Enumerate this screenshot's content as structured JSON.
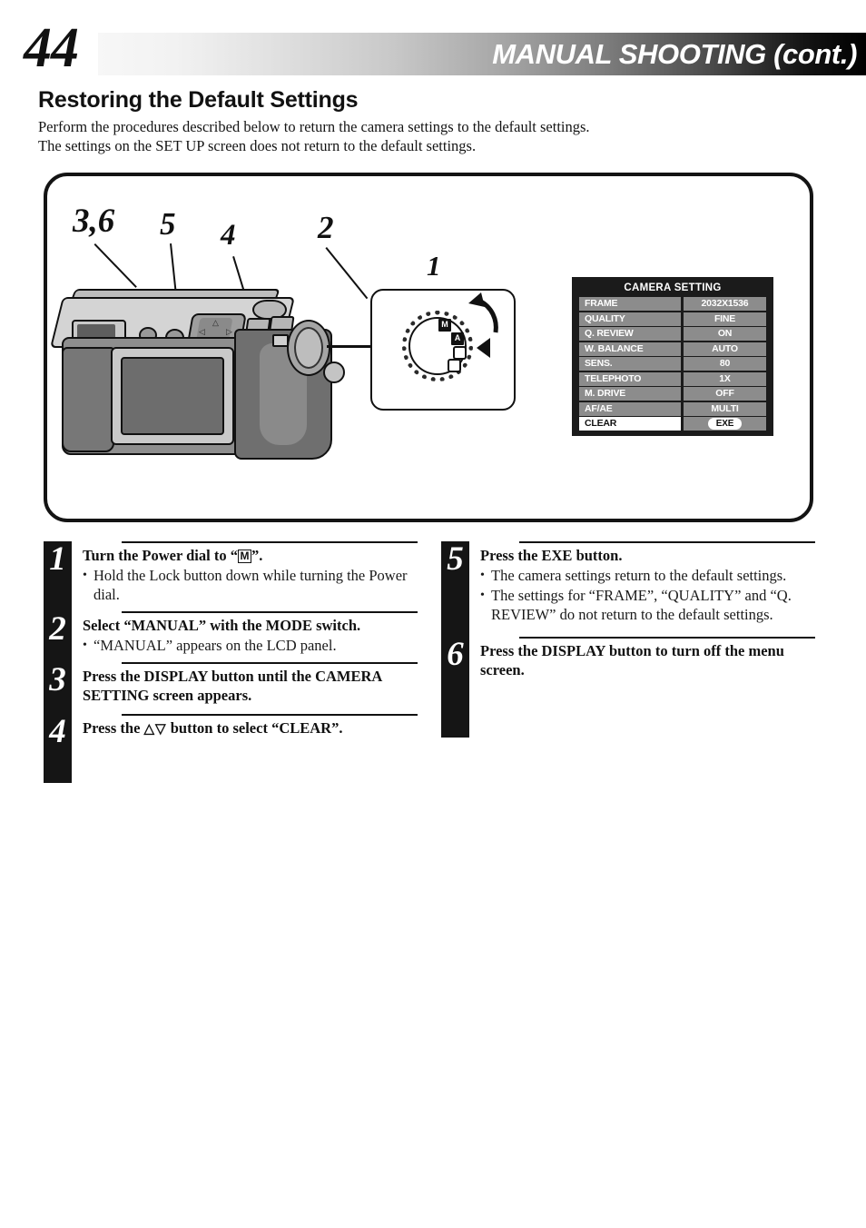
{
  "header": {
    "page_number": "44",
    "title": "MANUAL SHOOTING (cont.)"
  },
  "section": {
    "title": "Restoring the Default Settings",
    "intro_line1": "Perform the procedures described below to return the camera settings to the default settings.",
    "intro_line2": "The settings on the SET UP screen does not return to the default settings."
  },
  "illustration": {
    "callouts": [
      {
        "label": "3,6"
      },
      {
        "label": "5"
      },
      {
        "label": "4"
      },
      {
        "label": "2"
      },
      {
        "label": "1"
      }
    ],
    "dial_modes": [
      {
        "label": "M"
      },
      {
        "label": "A"
      },
      {
        "label": ""
      },
      {
        "label": ""
      }
    ],
    "pad_arrows": {
      "up": "△",
      "down": "▽",
      "left": "◁",
      "right": "▷"
    }
  },
  "lcd": {
    "title": "CAMERA SETTING",
    "rows": [
      {
        "label": "FRAME",
        "value": "2032X1536",
        "selected": false
      },
      {
        "label": "QUALITY",
        "value": "FINE",
        "selected": false
      },
      {
        "label": "Q. REVIEW",
        "value": "ON",
        "selected": false
      },
      {
        "label": "W. BALANCE",
        "value": "AUTO",
        "selected": false
      },
      {
        "label": "SENS.",
        "value": "80",
        "selected": false
      },
      {
        "label": "TELEPHOTO",
        "value": "1X",
        "selected": false
      },
      {
        "label": "M. DRIVE",
        "value": "OFF",
        "selected": false
      },
      {
        "label": "AF/AE",
        "value": "MULTI",
        "selected": false
      },
      {
        "label": "CLEAR",
        "value": "EXE",
        "selected": true
      }
    ],
    "colors": {
      "background": "#1b1b1b",
      "cell": "#8c8c8c",
      "selected_cell": "#ffffff",
      "text": "#ffffff"
    }
  },
  "steps": {
    "left": [
      {
        "number": "1",
        "heading_pre": "Turn the Power dial to “",
        "heading_box": "M",
        "heading_post": "”.",
        "bullets": [
          "Hold the Lock button down while turning the Power dial."
        ]
      },
      {
        "number": "2",
        "heading": "Select “MANUAL” with the MODE switch.",
        "bullets": [
          "“MANUAL” appears on the LCD panel."
        ]
      },
      {
        "number": "3",
        "heading": "Press the DISPLAY button until the CAMERA SETTING screen appears.",
        "bullets": []
      },
      {
        "number": "4",
        "heading_pre": "Press the ",
        "heading_tri": "△▽",
        "heading_post": " button to select “CLEAR”.",
        "bullets": []
      }
    ],
    "right": [
      {
        "number": "5",
        "heading": "Press the EXE button.",
        "bullets": [
          "The camera settings return to the default settings.",
          "The settings for “FRAME”, “QUALITY” and “Q. REVIEW” do not return to the default settings."
        ]
      },
      {
        "number": "6",
        "heading": "Press the DISPLAY button to turn off the menu screen.",
        "bullets": []
      }
    ]
  }
}
